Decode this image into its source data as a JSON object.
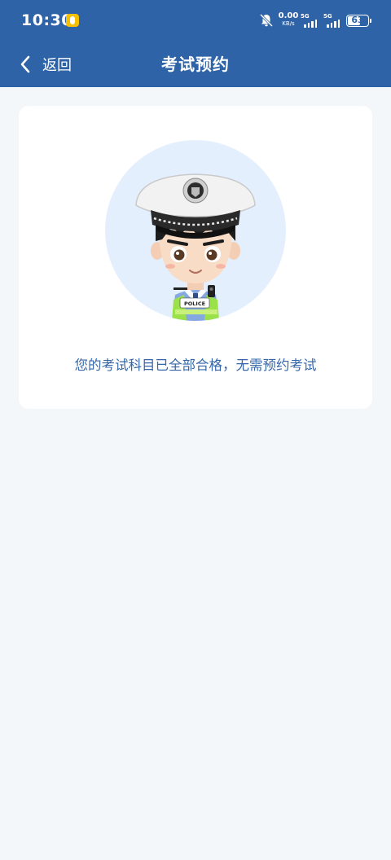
{
  "status_bar": {
    "time": "10:30",
    "net_speed_value": "0.00",
    "net_speed_unit": "KB/s",
    "sim1_label": "5G",
    "sim2_label": "5G",
    "battery_percent": "63",
    "battery_level": 0.63
  },
  "nav": {
    "back_label": "返回",
    "title": "考试预约"
  },
  "card": {
    "badge_text": "POLICE",
    "message": "您的考试科目已全部合格，无需预约考试"
  },
  "colors": {
    "header": "#2f63a8",
    "background": "#f3f7f9",
    "message_text": "#3567a8",
    "avatar_circle": "#e4effe"
  },
  "icons": {
    "back": "chevron-left-icon",
    "mute": "bell-off-icon",
    "avatar": "traffic-police-avatar"
  }
}
